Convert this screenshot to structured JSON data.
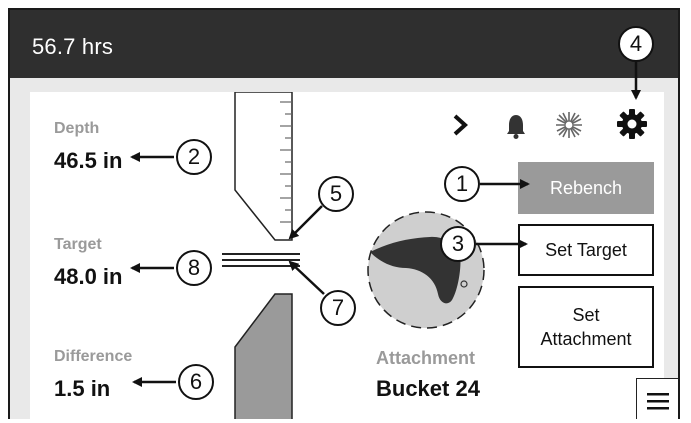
{
  "header": {
    "hours": "56.7 hrs"
  },
  "readouts": {
    "depth_label": "Depth",
    "depth_value": "46.5 in",
    "target_label": "Target",
    "target_value": "48.0 in",
    "difference_label": "Difference",
    "difference_value": "1.5 in"
  },
  "attachment": {
    "label": "Attachment",
    "value": "Bucket 24"
  },
  "buttons": {
    "rebench": "Rebench",
    "set_target": "Set Target",
    "set_attachment_line1": "Set",
    "set_attachment_line2": "Attachment"
  },
  "toolbar_icons": [
    "chevron-right-icon",
    "bell-icon",
    "laser-icon",
    "gear-icon",
    "menu-icon"
  ],
  "callouts": [
    "1",
    "2",
    "3",
    "4",
    "5",
    "6",
    "7",
    "8"
  ],
  "colors": {
    "titlebar": "#2f2f2f",
    "panel_bg": "#e9e9e9",
    "rebench_button": "#9a9a9a",
    "label_gray": "#9a9a9a",
    "bucket_fill": "#333333"
  }
}
